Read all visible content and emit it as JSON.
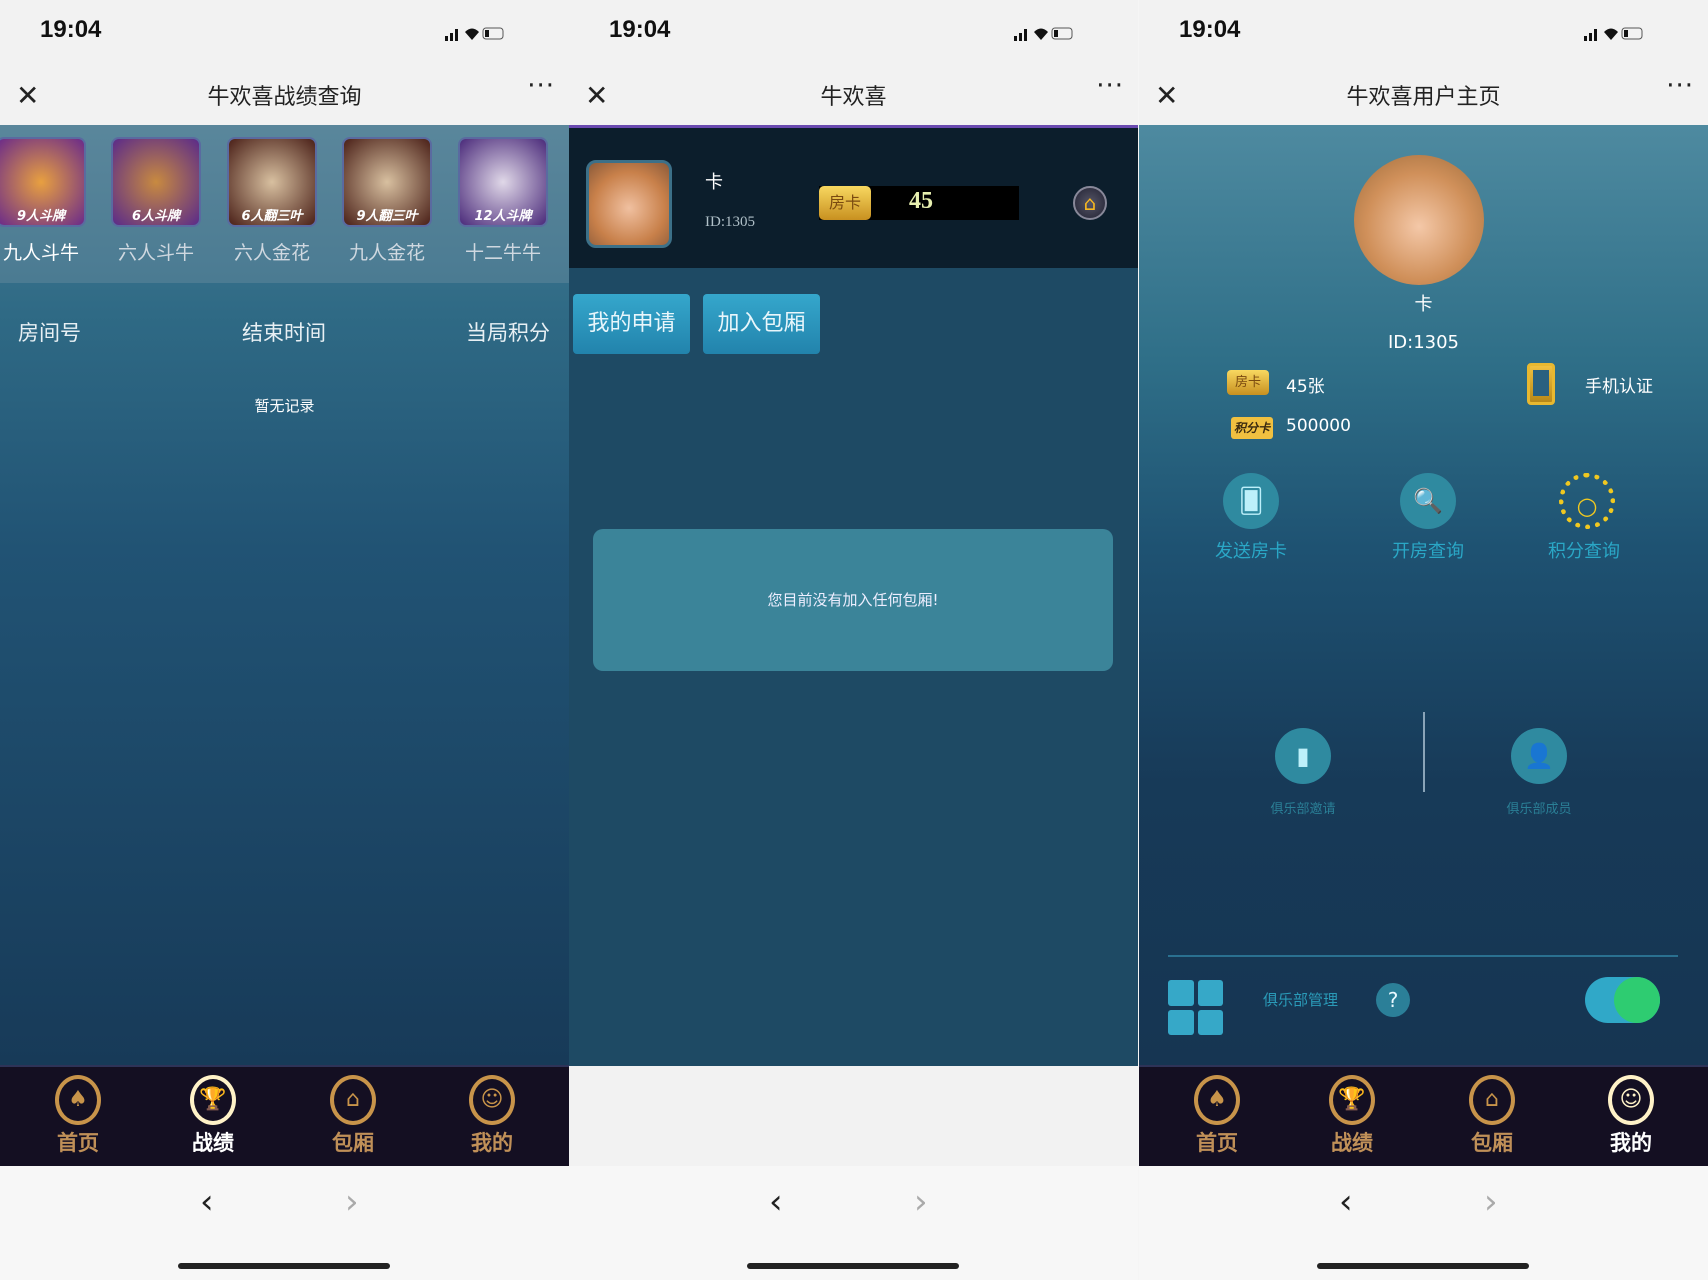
{
  "status": {
    "time": "19:04"
  },
  "panels": [
    {
      "title": "牛欢喜战绩查询",
      "games": [
        {
          "badge": "9人斗牌",
          "label": "九人斗牛"
        },
        {
          "badge": "6人斗牌",
          "label": "六人斗牛"
        },
        {
          "badge": "6人翻三叶",
          "label": "六人金花"
        },
        {
          "badge": "9人翻三叶",
          "label": "九人金花"
        },
        {
          "badge": "12人斗牌",
          "label": "十二牛牛"
        }
      ],
      "columns": [
        "房间号",
        "结束时间",
        "当局积分"
      ],
      "empty": "暂无记录",
      "active_tab": 1
    },
    {
      "title": "牛欢喜",
      "user": {
        "name": "卡",
        "id": "ID:1305"
      },
      "card_badge": "房卡",
      "card_count": "45",
      "buttons": [
        "我的申请",
        "加入包厢"
      ],
      "empty": "您目前没有加入任何包厢!"
    },
    {
      "title": "牛欢喜用户主页",
      "user": {
        "name": "卡",
        "id": "ID:1305"
      },
      "card_badge": "房卡",
      "cards": "45张",
      "points_badge": "积分卡",
      "points": "500000",
      "phone_verify": "手机认证",
      "actions": [
        "发送房卡",
        "开房查询",
        "积分查询"
      ],
      "club_actions": [
        "俱乐部邀请",
        "俱乐部成员"
      ],
      "club_manage": "俱乐部管理",
      "club_toggle_on": true,
      "active_tab": 3
    }
  ],
  "tabs": [
    "首页",
    "战绩",
    "包厢",
    "我的"
  ],
  "colors": {
    "accent_gold": "#c8944a",
    "toggle_on": "#2ecc71",
    "button_blue": "#2a98c0"
  }
}
